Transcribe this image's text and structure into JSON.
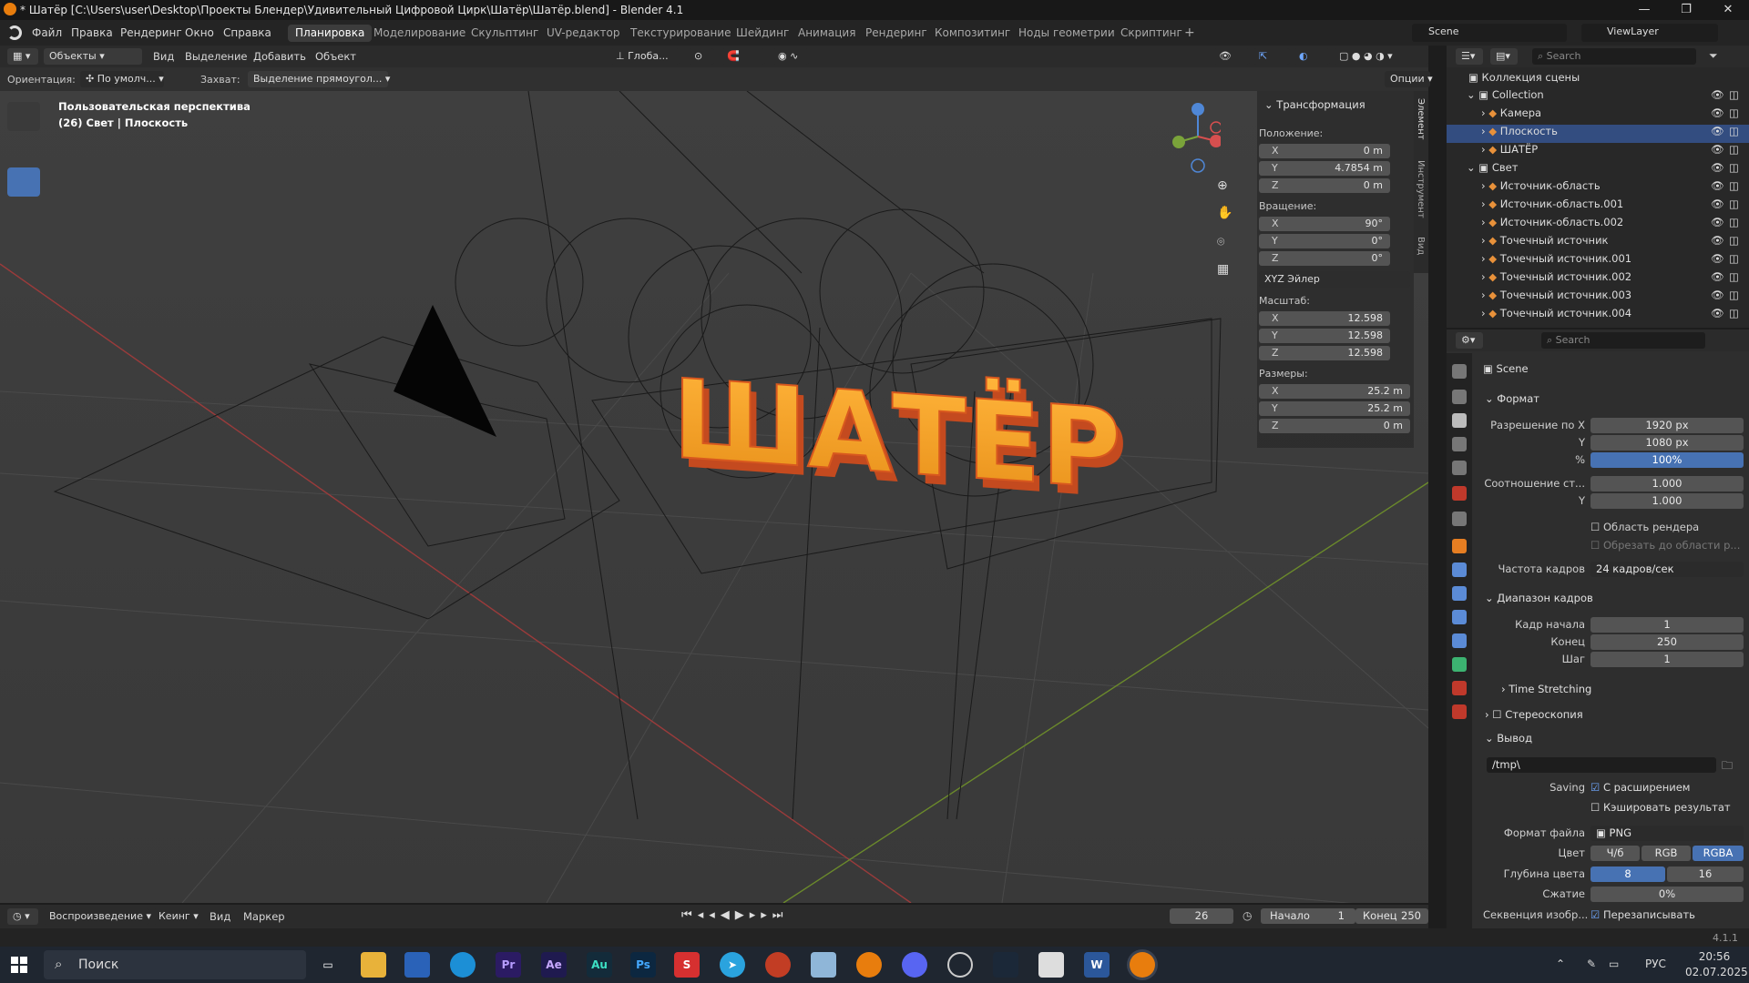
{
  "titlebar": {
    "title": "* Шатёр [C:\\Users\\user\\Desktop\\Проекты Блендер\\Удивительный Цифровой Цирк\\Шатёр\\Шатёр.blend] - Blender 4.1"
  },
  "menu": [
    "Файл",
    "Правка",
    "Рендеринг",
    "Окно",
    "Справка"
  ],
  "workspaces": [
    "Планировка",
    "Моделирование",
    "Скульптинг",
    "UV-редактор",
    "Текстурирование",
    "Шейдинг",
    "Анимация",
    "Рендеринг",
    "Композитинг",
    "Ноды геометрии",
    "Скриптинг"
  ],
  "workspace_active": "Планировка",
  "scene": "Scene",
  "viewlayer": "ViewLayer",
  "viewport_header": {
    "mode": "Объекты",
    "view": "Вид",
    "select": "Выделение",
    "add": "Добавить",
    "object": "Объект",
    "transform_orient": "Глоба...",
    "options": "Опции"
  },
  "tool_header": {
    "orientation_label": "Ориентация:",
    "orientation": "По умолч...",
    "snap_label": "Захват:",
    "snap": "Выделение прямоугол..."
  },
  "viewport_overlay": {
    "line1": "Пользовательская перспектива",
    "line2": "(26) Свет | Плоскость"
  },
  "text3d": "ШАТЁР",
  "transform": {
    "title": "Трансформация",
    "position_label": "Положение:",
    "position": [
      {
        "k": "X",
        "v": "0 m"
      },
      {
        "k": "Y",
        "v": "4.7854 m"
      },
      {
        "k": "Z",
        "v": "0 m"
      }
    ],
    "rotation_label": "Вращение:",
    "rotation": [
      {
        "k": "X",
        "v": "90°"
      },
      {
        "k": "Y",
        "v": "0°"
      },
      {
        "k": "Z",
        "v": "0°"
      }
    ],
    "rot_mode": "XYZ Эйлер",
    "scale_label": "Масштаб:",
    "scale": [
      {
        "k": "X",
        "v": "12.598"
      },
      {
        "k": "Y",
        "v": "12.598"
      },
      {
        "k": "Z",
        "v": "12.598"
      }
    ],
    "dims_label": "Размеры:",
    "dims": [
      {
        "k": "X",
        "v": "25.2 m"
      },
      {
        "k": "Y",
        "v": "25.2 m"
      },
      {
        "k": "Z",
        "v": "0 m"
      }
    ]
  },
  "npanel_tabs": [
    "Элемент",
    "Инструмент",
    "Вид"
  ],
  "outliner": {
    "search": "Search",
    "root": "Коллекция сцены",
    "rows": [
      {
        "name": "Collection",
        "indent": 1
      },
      {
        "name": "Камера",
        "indent": 2
      },
      {
        "name": "Плоскость",
        "indent": 2,
        "selected": true
      },
      {
        "name": "ШАТЁР",
        "indent": 2
      },
      {
        "name": "Свет",
        "indent": 1
      },
      {
        "name": "Источник-область",
        "indent": 2
      },
      {
        "name": "Источник-область.001",
        "indent": 2
      },
      {
        "name": "Источник-область.002",
        "indent": 2
      },
      {
        "name": "Точечный источник",
        "indent": 2
      },
      {
        "name": "Точечный источник.001",
        "indent": 2
      },
      {
        "name": "Точечный источник.002",
        "indent": 2
      },
      {
        "name": "Точечный источник.003",
        "indent": 2
      },
      {
        "name": "Точечный источник.004",
        "indent": 2
      }
    ]
  },
  "props": {
    "search": "Search",
    "scene": "Scene",
    "format": "Формат",
    "resx_label": "Разрешение по X",
    "resx": "1920 px",
    "resy_label": "Y",
    "resy": "1080 px",
    "pct_label": "%",
    "pct": "100%",
    "aspect_label": "Соотношение ст...",
    "aspx": "1.000",
    "aspy_label": "Y",
    "aspy": "1.000",
    "render_region": "Область рендера",
    "crop": "Обрезать до области р...",
    "fps_label": "Частота кадров",
    "fps": "24 кадров/сек",
    "frame_range": "Диапазон кадров",
    "start_label": "Кадр начала",
    "start": "1",
    "end_label": "Конец",
    "end": "250",
    "step_label": "Шаг",
    "step": "1",
    "time_stretching": "Time Stretching",
    "stereo": "Стереоскопия",
    "output": "Вывод",
    "path": "/tmp\\",
    "saving_label": "Saving",
    "with_ext": "С расширением",
    "cache": "Кэшировать результат",
    "file_format_label": "Формат файла",
    "file_format": "PNG",
    "color_label": "Цвет",
    "color_opts": [
      "Ч/б",
      "RGB",
      "RGBA"
    ],
    "depth_label": "Глубина цвета",
    "depth_opts": [
      "8",
      "16"
    ],
    "compress_label": "Сжатие",
    "compress": "0%",
    "seq_label": "Секвенция изобр...",
    "overwrite": "Перезаписывать"
  },
  "timeline": {
    "playback": "Воспроизведение",
    "keying": "Кеинг",
    "view": "Вид",
    "marker": "Маркер",
    "current": "26",
    "start_label": "Начало",
    "start": "1",
    "end_label": "Конец",
    "end": "250"
  },
  "version": "4.1.1",
  "taskbar": {
    "search": "Поиск",
    "lang": "РУС",
    "time": "20:56",
    "date": "02.07.2025"
  }
}
